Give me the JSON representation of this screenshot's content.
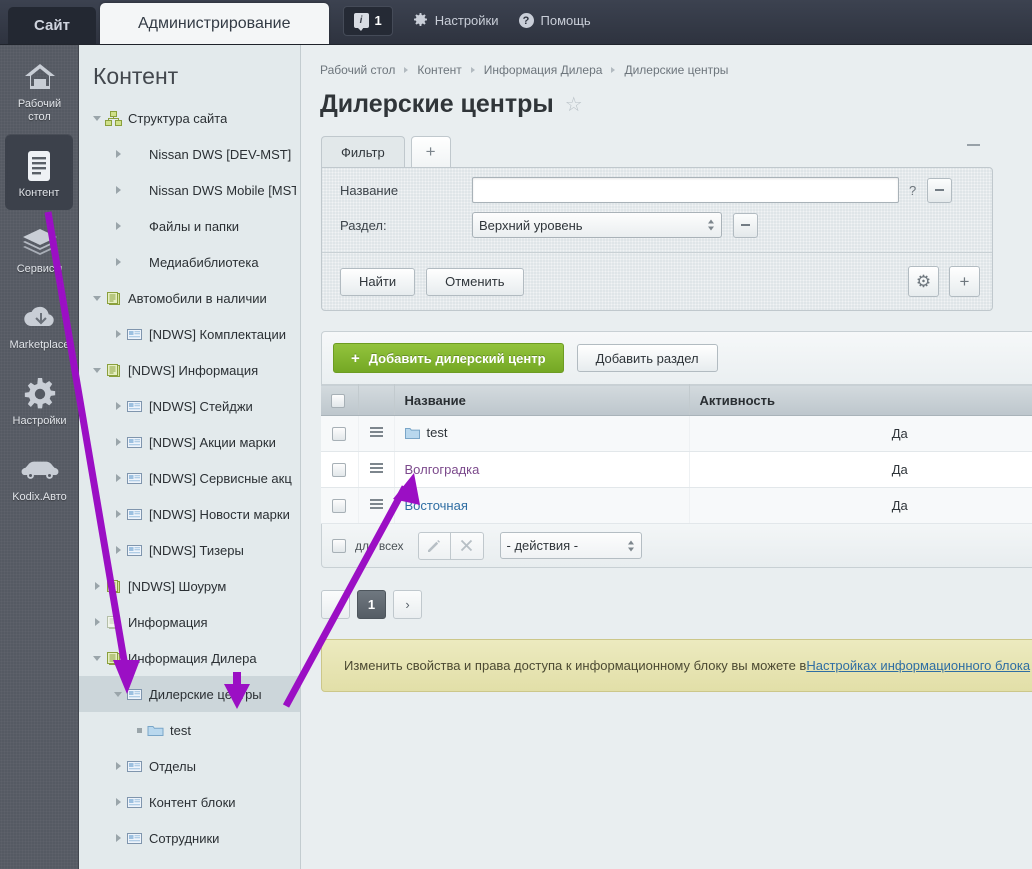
{
  "topbar": {
    "site_tab": "Сайт",
    "admin_tab": "Администрирование",
    "counter": "1",
    "settings": "Настройки",
    "help": "Помощь"
  },
  "rail": {
    "items": [
      {
        "label": "Рабочий\nстол",
        "icon": "home-icon",
        "selected": false
      },
      {
        "label": "Контент",
        "icon": "document-icon",
        "selected": true
      },
      {
        "label": "Сервисы",
        "icon": "layers-icon",
        "selected": false
      },
      {
        "label": "Marketplace",
        "icon": "cloud-download-icon",
        "selected": false
      },
      {
        "label": "Настройки",
        "icon": "gear-icon",
        "selected": false
      },
      {
        "label": "Kodix.Авто",
        "icon": "car-icon",
        "selected": false
      }
    ]
  },
  "tree": {
    "title": "Контент",
    "nodes": [
      {
        "label": "Структура сайта",
        "depth": 0,
        "state": "open",
        "icon": "sitemap"
      },
      {
        "label": "Nissan DWS [DEV-MST]",
        "depth": 1,
        "state": "closed",
        "icon": "none"
      },
      {
        "label": "Nissan DWS Mobile [MST]",
        "depth": 1,
        "state": "closed",
        "icon": "none"
      },
      {
        "label": "Файлы и папки",
        "depth": 1,
        "state": "closed",
        "icon": "none"
      },
      {
        "label": "Медиабиблиотека",
        "depth": 1,
        "state": "closed",
        "icon": "none"
      },
      {
        "label": "Автомобили в наличии",
        "depth": 0,
        "state": "open",
        "icon": "iblock"
      },
      {
        "label": "[NDWS] Комплектации",
        "depth": 1,
        "state": "closed",
        "icon": "section"
      },
      {
        "label": "[NDWS] Информация",
        "depth": 0,
        "state": "open",
        "icon": "iblock"
      },
      {
        "label": "[NDWS] Стейджи",
        "depth": 1,
        "state": "closed",
        "icon": "section"
      },
      {
        "label": "[NDWS] Акции марки",
        "depth": 1,
        "state": "closed",
        "icon": "section"
      },
      {
        "label": "[NDWS] Сервисные акц",
        "depth": 1,
        "state": "closed",
        "icon": "section"
      },
      {
        "label": "[NDWS] Новости марки",
        "depth": 1,
        "state": "closed",
        "icon": "section"
      },
      {
        "label": "[NDWS] Тизеры",
        "depth": 1,
        "state": "closed",
        "icon": "section"
      },
      {
        "label": "[NDWS] Шоурум",
        "depth": 0,
        "state": "closed",
        "icon": "iblock"
      },
      {
        "label": "Информация",
        "depth": 0,
        "state": "closed",
        "icon": "iblock-pale"
      },
      {
        "label": "Информация Дилера",
        "depth": 0,
        "state": "open",
        "icon": "iblock"
      },
      {
        "label": "Дилерские центры",
        "depth": 1,
        "state": "open",
        "icon": "section",
        "active": true
      },
      {
        "label": "test",
        "depth": 2,
        "state": "leaf",
        "icon": "folder"
      },
      {
        "label": "Отделы",
        "depth": 1,
        "state": "closed",
        "icon": "section"
      },
      {
        "label": "Контент блоки",
        "depth": 1,
        "state": "closed",
        "icon": "section"
      },
      {
        "label": "Сотрудники",
        "depth": 1,
        "state": "closed",
        "icon": "section"
      }
    ]
  },
  "breadcrumb": [
    "Рабочий стол",
    "Контент",
    "Информация Дилера",
    "Дилерские центры"
  ],
  "page": {
    "title": "Дилерские центры",
    "star": "☆"
  },
  "filter": {
    "tab_label": "Фильтр",
    "add_tab": "+",
    "name_label": "Название",
    "name_value": "",
    "help": "?",
    "section_label": "Раздел:",
    "section_value": "Верхний уровень",
    "find_button": "Найти",
    "cancel_button": "Отменить",
    "gear_button": "⚙",
    "plus_button": "+"
  },
  "toolbar": {
    "add_dealer": "Добавить дилерский центр",
    "add_section": "Добавить раздел"
  },
  "grid": {
    "columns": [
      "Название",
      "Активность"
    ],
    "rows": [
      {
        "name": "test",
        "active": "Да",
        "type": "folder",
        "link": false
      },
      {
        "name": "Волгоградка",
        "active": "Да",
        "type": "item",
        "link": true,
        "visited": true
      },
      {
        "name": "Восточная",
        "active": "Да",
        "type": "item",
        "link": true,
        "visited": false
      }
    ],
    "footer": {
      "for_all": "для всех",
      "edit_icon": "✎",
      "delete_icon": "✕",
      "actions_select": "- действия -"
    }
  },
  "pager": {
    "prev": "",
    "current": "1",
    "next": "›"
  },
  "notice": {
    "text": "Изменить свойства и права доступа к информационному блоку вы можете в ",
    "link": "Настройках информационного блока"
  },
  "colors": {
    "accent_green": "#7eb32b",
    "link_blue": "#2f6ea3",
    "visited_purple": "#7c4a8c",
    "annotation": "#9b0fc4",
    "topbar_dark": "#2e333f",
    "notice_bg": "#e8e5b4"
  }
}
